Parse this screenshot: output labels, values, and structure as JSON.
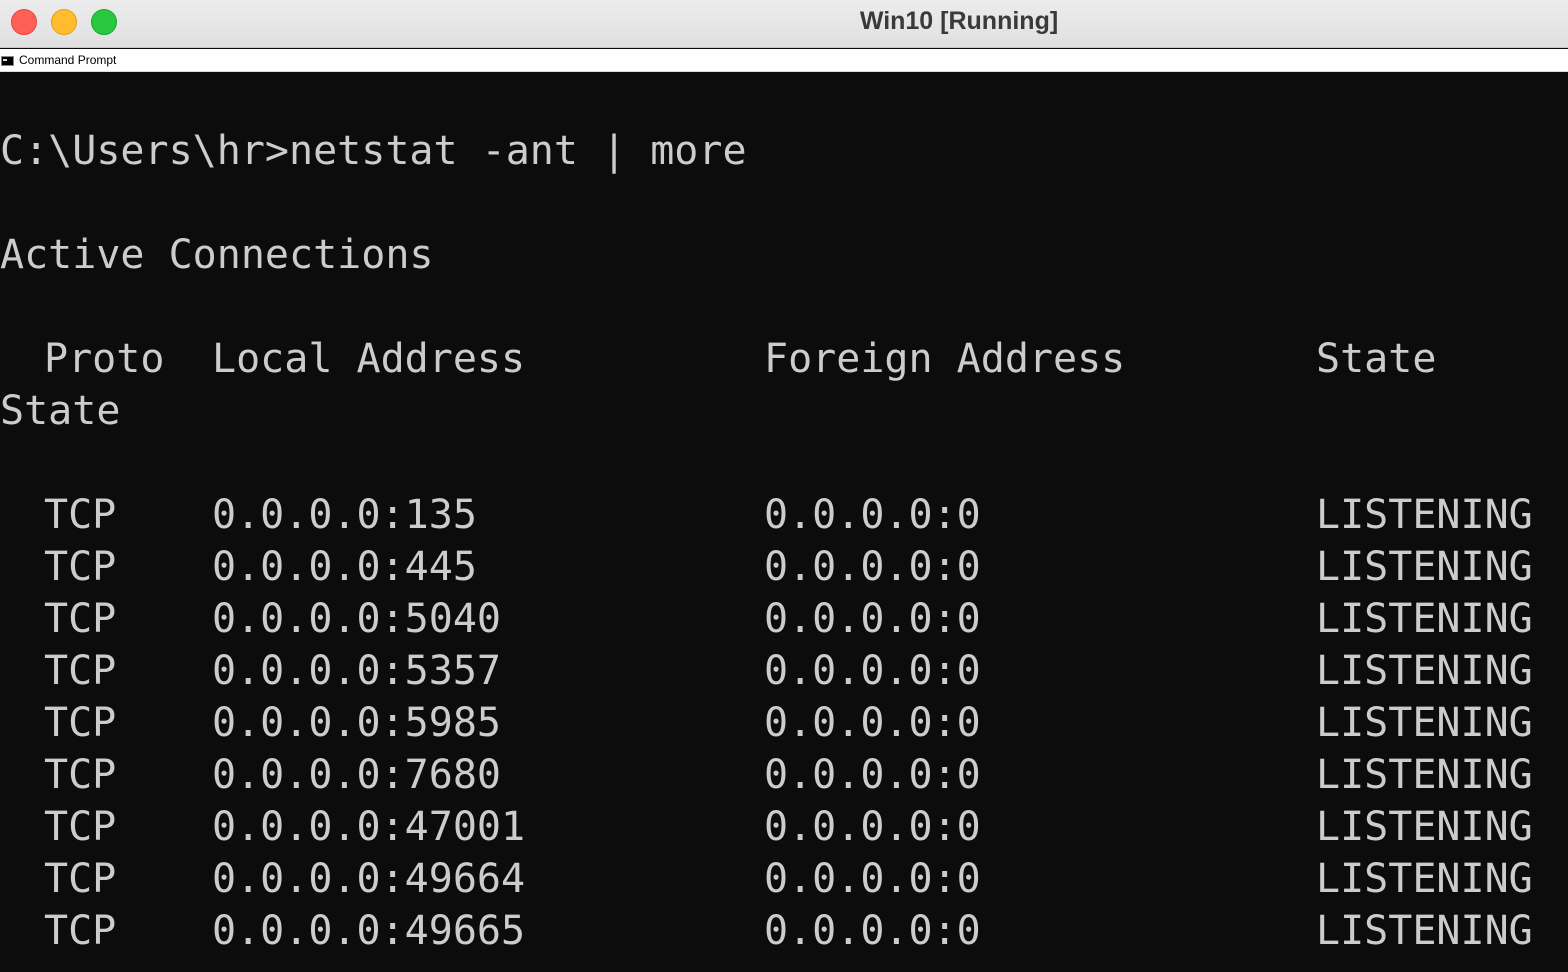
{
  "window": {
    "title": "Win10 [Running]"
  },
  "console_window": {
    "title": "Command Prompt",
    "icon": "cmd-icon"
  },
  "terminal": {
    "command_line": "C:\\Users\\hr>netstat -ant | more",
    "heading": "Active Connections",
    "columns": {
      "proto": "Proto",
      "local": "Local Address",
      "foreign": "Foreign Address",
      "state": "State",
      "wrapped": "State"
    },
    "rows": [
      {
        "proto": "TCP",
        "local": "0.0.0.0:135",
        "foreign": "0.0.0.0:0",
        "state": "LISTENING"
      },
      {
        "proto": "TCP",
        "local": "0.0.0.0:445",
        "foreign": "0.0.0.0:0",
        "state": "LISTENING"
      },
      {
        "proto": "TCP",
        "local": "0.0.0.0:5040",
        "foreign": "0.0.0.0:0",
        "state": "LISTENING"
      },
      {
        "proto": "TCP",
        "local": "0.0.0.0:5357",
        "foreign": "0.0.0.0:0",
        "state": "LISTENING"
      },
      {
        "proto": "TCP",
        "local": "0.0.0.0:5985",
        "foreign": "0.0.0.0:0",
        "state": "LISTENING"
      },
      {
        "proto": "TCP",
        "local": "0.0.0.0:7680",
        "foreign": "0.0.0.0:0",
        "state": "LISTENING"
      },
      {
        "proto": "TCP",
        "local": "0.0.0.0:47001",
        "foreign": "0.0.0.0:0",
        "state": "LISTENING"
      },
      {
        "proto": "TCP",
        "local": "0.0.0.0:49664",
        "foreign": "0.0.0.0:0",
        "state": "LISTENING"
      },
      {
        "proto": "TCP",
        "local": "0.0.0.0:49665",
        "foreign": "0.0.0.0:0",
        "state": "LISTENING"
      }
    ]
  },
  "colors": {
    "console_background": "#0c0c0c",
    "console_text": "#cccccc",
    "close_button": "#fe5f57",
    "minimize_button": "#febc2e",
    "maximize_button": "#28c840"
  }
}
